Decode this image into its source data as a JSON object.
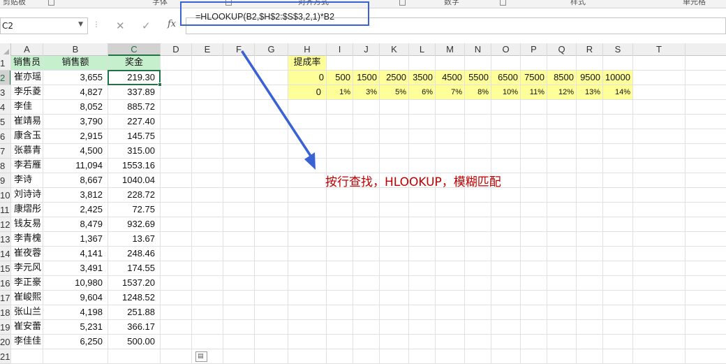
{
  "ribbon": {
    "groups": [
      {
        "id": "clipboard",
        "label": "剪贴板"
      },
      {
        "id": "font",
        "label": "字体"
      },
      {
        "id": "alignment",
        "label": "对齐方式"
      },
      {
        "id": "number",
        "label": "数字"
      },
      {
        "id": "styles",
        "label": "样式"
      },
      {
        "id": "cells",
        "label": "单元格"
      }
    ]
  },
  "formula_bar": {
    "name_box": "C2",
    "cancel_icon": "✕",
    "enter_icon": "✓",
    "fx_label": "fx",
    "formula": "=HLOOKUP(B2,$H$2:$S$3,2,1)*B2"
  },
  "columns": [
    "A",
    "B",
    "C",
    "D",
    "E",
    "F",
    "G",
    "H",
    "I",
    "J",
    "K",
    "L",
    "M",
    "N",
    "O",
    "P",
    "Q",
    "R",
    "S",
    "T"
  ],
  "selected_column": "C",
  "rows": [
    "1",
    "2",
    "3",
    "4",
    "5",
    "6",
    "7",
    "8",
    "9",
    "10",
    "11",
    "12",
    "13",
    "14",
    "15",
    "16",
    "17",
    "18",
    "19",
    "20",
    "21"
  ],
  "selected_row": "2",
  "sales_table": {
    "headers": [
      "销售员",
      "销售额",
      "奖金"
    ],
    "rows": [
      [
        "崔亦瑶",
        "3,655",
        "219.30"
      ],
      [
        "李乐菱",
        "4,827",
        "337.89"
      ],
      [
        "李佳",
        "8,052",
        "885.72"
      ],
      [
        "崔靖易",
        "3,790",
        "227.40"
      ],
      [
        "康含玉",
        "2,915",
        "145.75"
      ],
      [
        "张慕青",
        "4,500",
        "315.00"
      ],
      [
        "李若雁",
        "11,094",
        "1553.16"
      ],
      [
        "李诗",
        "8,667",
        "1040.04"
      ],
      [
        "刘诗诗",
        "3,812",
        "228.72"
      ],
      [
        "康熠彤",
        "2,425",
        "72.75"
      ],
      [
        "钱友易",
        "8,479",
        "932.69"
      ],
      [
        "李青槐",
        "1,367",
        "13.67"
      ],
      [
        "崔夜蓉",
        "4,141",
        "248.46"
      ],
      [
        "李元风",
        "3,491",
        "174.55"
      ],
      [
        "李正豪",
        "10,980",
        "1537.20"
      ],
      [
        "崔峻熙",
        "9,604",
        "1248.52"
      ],
      [
        "张山兰",
        "4,198",
        "251.88"
      ],
      [
        "崔安蕾",
        "5,231",
        "366.17"
      ],
      [
        "李佳佳",
        "6,250",
        "500.00"
      ]
    ]
  },
  "rate_table": {
    "header": "提成率",
    "thresholds": [
      "0",
      "500",
      "1500",
      "2500",
      "3500",
      "4500",
      "5500",
      "6500",
      "7500",
      "8500",
      "9500",
      "10000"
    ],
    "rates": [
      "0",
      "1%",
      "3%",
      "5%",
      "6%",
      "7%",
      "8%",
      "10%",
      "11%",
      "12%",
      "13%",
      "14%"
    ]
  },
  "annotation": "按行查找，HLOOKUP，模糊匹配",
  "colors": {
    "header_fill": "#c6efce",
    "rate_fill": "#ffff99",
    "highlight_box": "#3a62d4",
    "annotation": "#c00000",
    "selection": "#217346"
  },
  "icons": {
    "name_box_dropdown": "chevron-down-icon",
    "quick_analysis": "quick-analysis-icon"
  }
}
